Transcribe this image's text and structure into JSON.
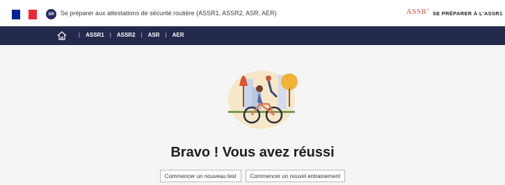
{
  "header": {
    "flag_colors": [
      "#002395",
      "#ffffff",
      "#ed2939"
    ],
    "badge_text": "SR",
    "site_title": "Se préparer aux attestations de sécurité routière (ASSR1, ASSR2, ASR, AER)",
    "logo_text": "ASSR",
    "logo_sup": "1",
    "prep_link": "SE PRÉPARER À L'ASSR1"
  },
  "nav": {
    "home_icon": "home-icon",
    "items": [
      "ASSR1",
      "ASSR2",
      "ASR",
      "AER"
    ],
    "separator": "|"
  },
  "main": {
    "headline": "Bravo ! Vous avez réussi",
    "buttons": {
      "new_test": "Commencer un nouveau test",
      "new_training": "Commencer un nouvel entrainement"
    }
  },
  "colors": {
    "navbar_bg": "#242a4c",
    "accent_red": "#d6503f",
    "page_bg": "#f5f5f5"
  }
}
